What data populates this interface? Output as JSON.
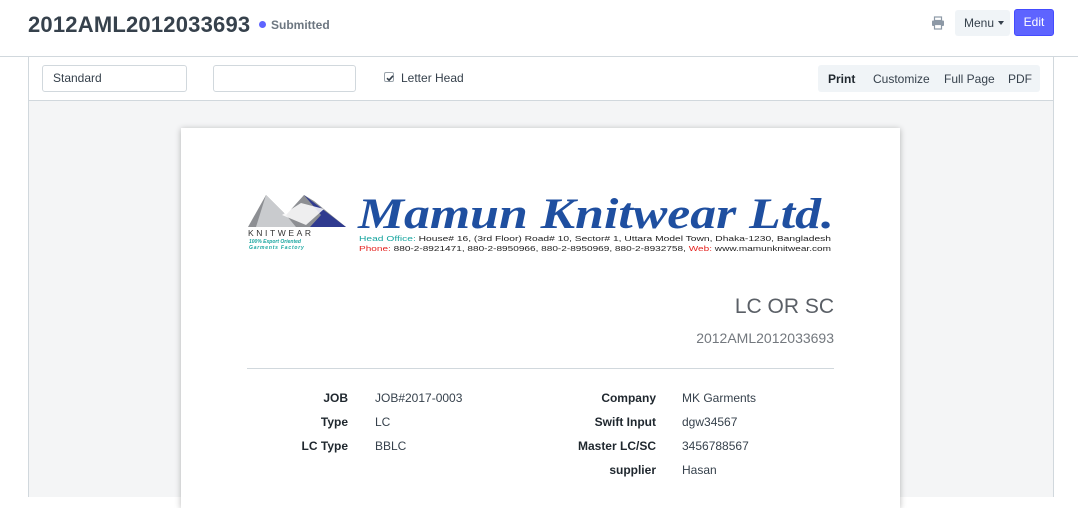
{
  "header": {
    "title": "2012AML2012033693",
    "status": "Submitted",
    "menu_label": "Menu",
    "edit_label": "Edit",
    "status_color": "#5e64ff",
    "primary_color": "#5e64ff"
  },
  "toolbar": {
    "print_format": "Standard",
    "language": "",
    "letter_head_label": "Letter Head",
    "letter_head_checked": true,
    "buttons": [
      "Print",
      "Customize",
      "Full Page",
      "PDF"
    ]
  },
  "letterhead": {
    "company_name": "Mamun Knitwear Ltd.",
    "logo_text": "KNITWEAR",
    "tagline_1": "100% Export Oriented",
    "tagline_2": "Garments Factory",
    "head_office_label": "Head Office:",
    "head_office": "House# 16, (3rd Floor) Road# 10, Sector# 1, Uttara Model Town, Dhaka-1230, Bangladesh",
    "phone_label": "Phone:",
    "phone": "880-2-8921471, 880-2-8950966, 880-2-8950969, 880-2-8932758,",
    "web_label": "Web:",
    "web": "www.mamunknitwear.com"
  },
  "document": {
    "heading": "LC OR SC",
    "subheading": "2012AML2012033693",
    "left_fields": [
      {
        "label": "JOB",
        "value": "JOB#2017-0003"
      },
      {
        "label": "Type",
        "value": "LC"
      },
      {
        "label": "LC Type",
        "value": "BBLC"
      }
    ],
    "right_fields": [
      {
        "label": "Company",
        "value": "MK Garments"
      },
      {
        "label": "Swift Input",
        "value": "dgw34567"
      },
      {
        "label": "Master LC/SC",
        "value": "3456788567"
      },
      {
        "label": "supplier",
        "value": "Hasan"
      }
    ]
  }
}
